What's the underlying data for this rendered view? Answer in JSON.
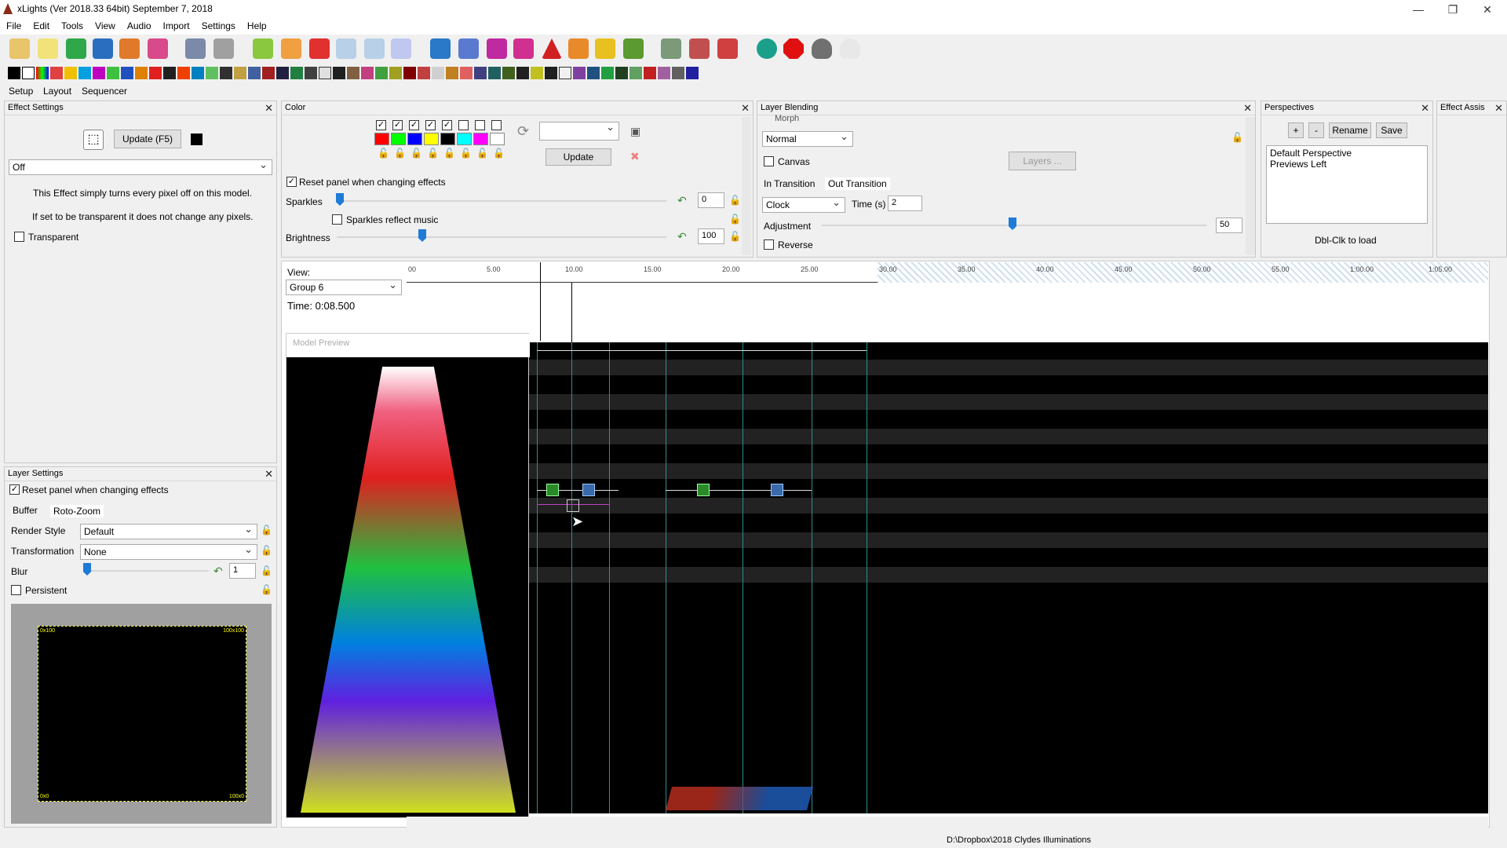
{
  "titlebar": {
    "title": "xLights  (Ver 2018.33 64bit) September 7, 2018"
  },
  "menu": [
    "File",
    "Edit",
    "Tools",
    "View",
    "Audio",
    "Import",
    "Settings",
    "Help"
  ],
  "tabs": [
    "Setup",
    "Layout",
    "Sequencer"
  ],
  "effect_settings": {
    "title": "Effect Settings",
    "update_label": "Update (F5)",
    "effect_value": "Off",
    "desc1": "This Effect simply turns every pixel off on this model.",
    "desc2": "If set to be transparent it does not change any pixels.",
    "transparent_label": "Transparent"
  },
  "color": {
    "title": "Color",
    "update_label": "Update",
    "reset_label": "Reset panel when changing effects",
    "sparkles_label": "Sparkles",
    "sparkles_value": "0",
    "sparkles_music_label": "Sparkles reflect music",
    "brightness_label": "Brightness",
    "brightness_value": "100",
    "palette_colors": [
      "#ff0000",
      "#00ff00",
      "#0000ff",
      "#ffff00",
      "#000000",
      "#00ffff",
      "#ff00ff",
      "#ffffff"
    ]
  },
  "layer_blending": {
    "title": "Layer Blending",
    "morph_label": "Morph",
    "blend_mode": "Normal",
    "canvas_label": "Canvas",
    "layers_label": "Layers ...",
    "in_transition": "In Transition",
    "out_transition": "Out Transition",
    "transition_type": "Clock",
    "time_label": "Time (s)",
    "time_value": "2",
    "adjustment_label": "Adjustment",
    "adjustment_value": "50",
    "reverse_label": "Reverse"
  },
  "perspectives": {
    "title": "Perspectives",
    "add": "+",
    "remove": "-",
    "rename": "Rename",
    "save": "Save",
    "items": [
      "Default Perspective",
      "Previews Left"
    ],
    "hint": "Dbl-Clk to load"
  },
  "effect_assist": {
    "title": "Effect Assis"
  },
  "layer_settings": {
    "title": "Layer Settings",
    "reset_label": "Reset panel when changing effects",
    "tab_buffer": "Buffer",
    "tab_rotozoom": "Roto-Zoom",
    "render_style_label": "Render Style",
    "render_style_value": "Default",
    "transformation_label": "Transformation",
    "transformation_value": "None",
    "blur_label": "Blur",
    "blur_value": "1",
    "persistent_label": "Persistent",
    "corner_tl": "0x100",
    "corner_tr": "100x100",
    "corner_bl": "0x0",
    "corner_br": "100x0"
  },
  "view": {
    "label": "View:",
    "value": "Group 6",
    "time": "Time: 0:08.500"
  },
  "timeline": {
    "ticks": [
      "00",
      "5.00",
      "10.00",
      "15.00",
      "20.00",
      "25.00",
      "30.00",
      "35.00",
      "40.00",
      "45.00",
      "50.00",
      "55.00",
      "1:00.00",
      "1:05.00"
    ]
  },
  "model_preview": {
    "title": "Model Preview"
  },
  "statusbar": {
    "path": "D:\\Dropbox\\2018 Clydes Illuminations"
  }
}
